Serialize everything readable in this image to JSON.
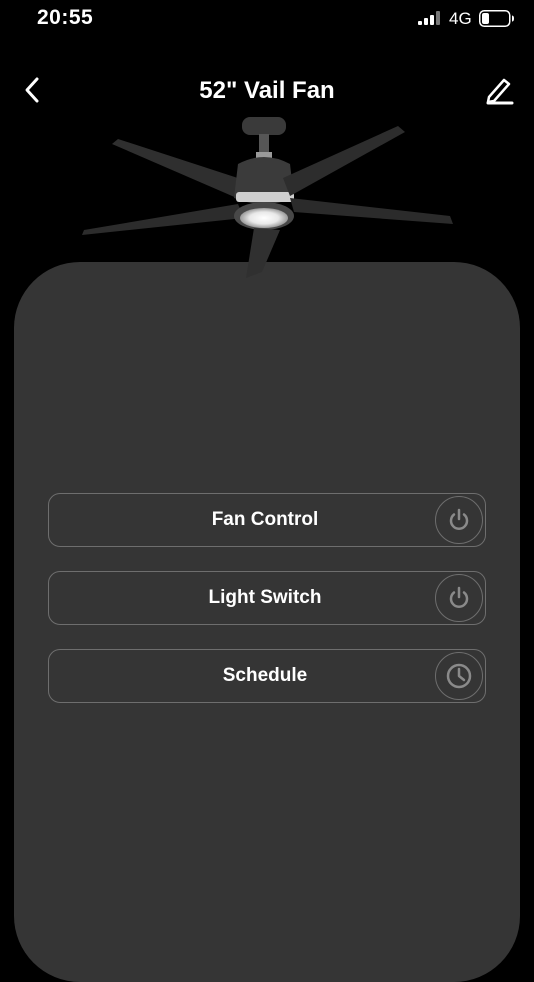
{
  "status_bar": {
    "time": "20:55",
    "network": "4G",
    "signal_icon": "cellular-signal-icon",
    "battery_icon": "battery-low-icon"
  },
  "header": {
    "title": "52\" Vail Fan",
    "back_icon": "chevron-left-icon",
    "edit_icon": "pencil-icon"
  },
  "controls": [
    {
      "label": "Fan Control",
      "icon": "power-icon"
    },
    {
      "label": "Light Switch",
      "icon": "power-icon"
    },
    {
      "label": "Schedule",
      "icon": "clock-icon"
    }
  ],
  "colors": {
    "background": "#000000",
    "panel": "#353535",
    "row_border": "#6e6e6e",
    "icon": "#8a8a8a"
  }
}
